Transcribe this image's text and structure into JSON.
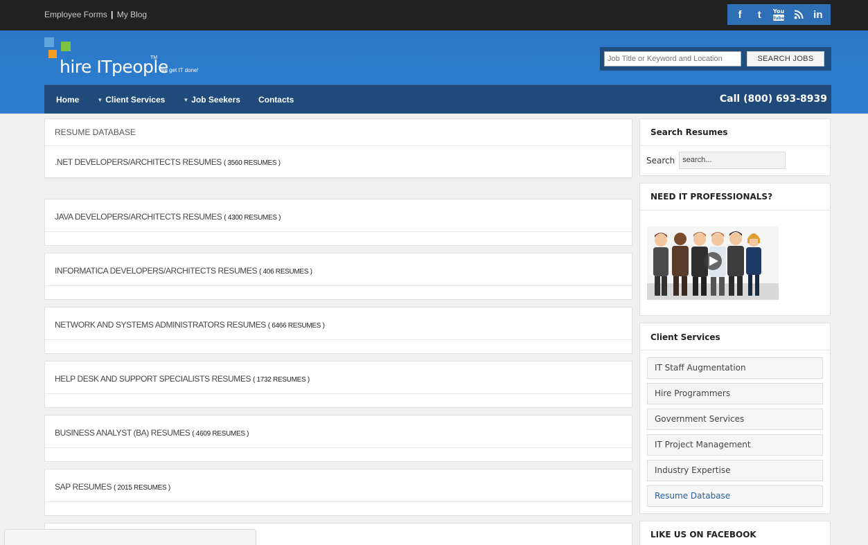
{
  "topbar": {
    "links": [
      "Employee Forms",
      "My Blog"
    ],
    "separator": "|",
    "social_icons": [
      "facebook-icon",
      "twitter-icon",
      "youtube-icon",
      "rss-icon",
      "linkedin-icon"
    ]
  },
  "header": {
    "logo_text": "hire ITpeople",
    "logo_tm": "TM",
    "logo_tagline": "We get IT done!",
    "search_placeholder": "Job Title or Keyword and Location",
    "search_button": "SEARCH JOBS"
  },
  "nav": {
    "items": [
      {
        "label": "Home",
        "dropdown": false
      },
      {
        "label": "Client Services",
        "dropdown": true
      },
      {
        "label": "Job Seekers",
        "dropdown": true
      },
      {
        "label": "Contacts",
        "dropdown": false
      }
    ],
    "phone": "Call (800) 693-8939"
  },
  "main": {
    "heading": "RESUME DATABASE",
    "categories": [
      {
        "label": ".NET DEVELOPERS/ARCHITECTS RESUMES",
        "count": "( 3560 RESUMES )"
      },
      {
        "label": "JAVA DEVELOPERS/ARCHITECTS RESUMES",
        "count": "( 4300 RESUMES )"
      },
      {
        "label": "INFORMATICA DEVELOPERS/ARCHITECTS RESUMES",
        "count": "( 406 RESUMES )"
      },
      {
        "label": "NETWORK AND SYSTEMS ADMINISTRATORS RESUMES",
        "count": "( 6466 RESUMES )"
      },
      {
        "label": "HELP DESK AND SUPPORT SPECIALISTS RESUMES",
        "count": "( 1732 RESUMES )"
      },
      {
        "label": "BUSINESS ANALYST (BA) RESUMES",
        "count": "( 4609 RESUMES )"
      },
      {
        "label": "SAP RESUMES",
        "count": "( 2015 RESUMES )"
      }
    ]
  },
  "sidebar": {
    "search_title": "Search Resumes",
    "search_label": "Search",
    "search_placeholder": "search...",
    "pros_title": "NEED IT PROFESSIONALS?",
    "services_title": "Client Services",
    "services": [
      {
        "label": "IT Staff Augmentation",
        "active": false
      },
      {
        "label": "Hire Programmers",
        "active": false
      },
      {
        "label": "Government Services",
        "active": false
      },
      {
        "label": "IT Project Management",
        "active": false
      },
      {
        "label": "Industry Expertise",
        "active": false
      },
      {
        "label": "Resume Database",
        "active": true
      }
    ],
    "facebook_title": "LIKE US ON FACEBOOK"
  },
  "colors": {
    "header_blue": "#2c7bcd",
    "nav_dark_blue": "#204a7a",
    "topbar_black": "#222222",
    "social_blue": "#2f6fb5",
    "active_link": "#2b5d9a"
  }
}
